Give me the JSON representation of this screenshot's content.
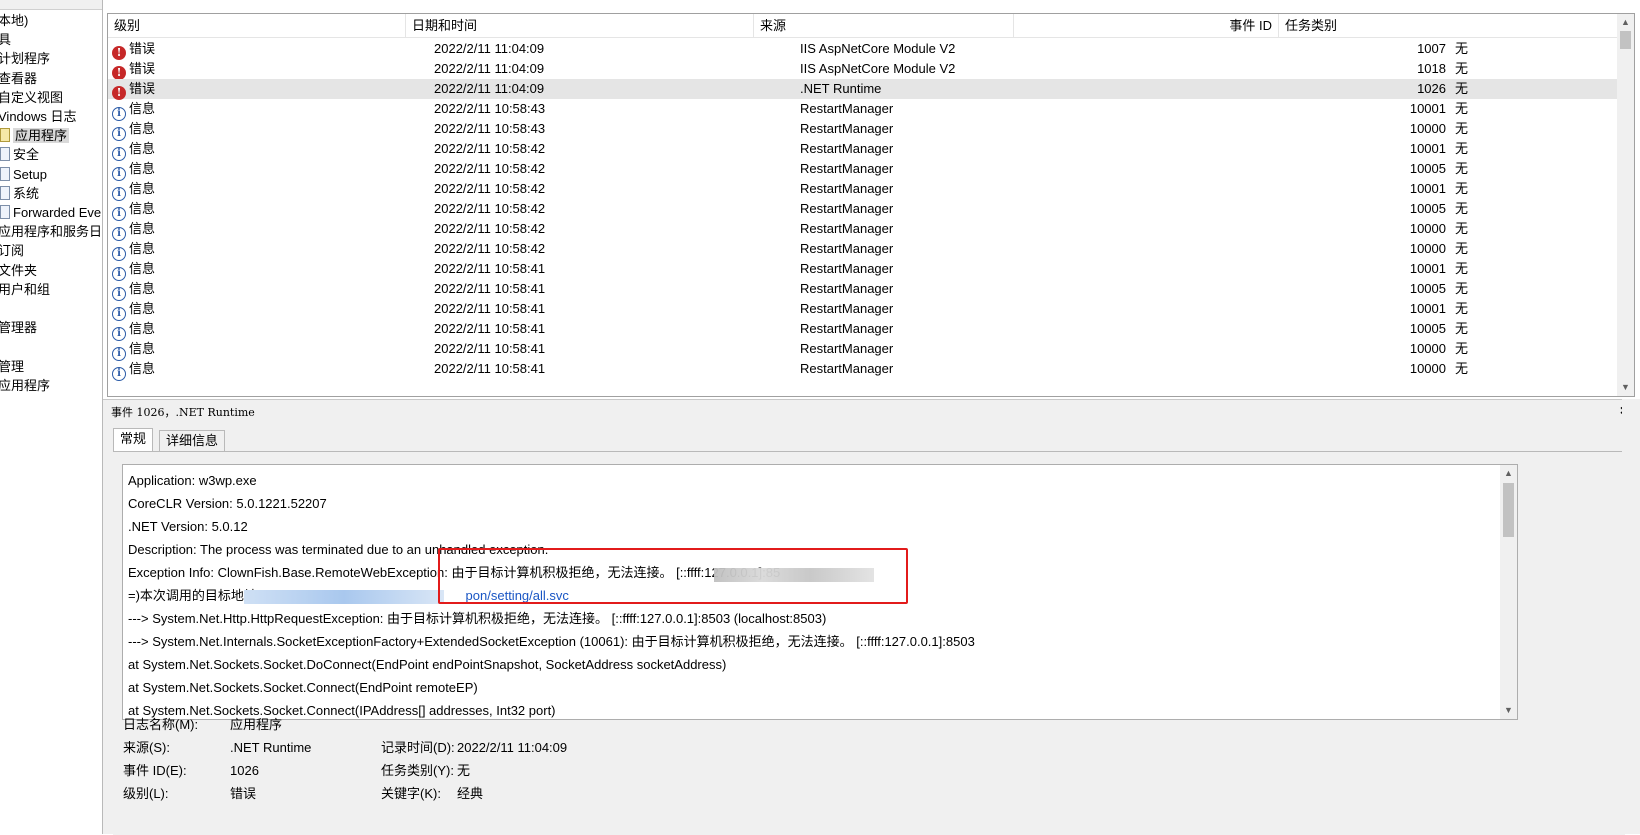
{
  "tree": {
    "items": [
      {
        "label": "本地)",
        "icon": "",
        "selected": false
      },
      {
        "label": "具",
        "icon": "",
        "selected": false
      },
      {
        "label": "计划程序",
        "icon": "",
        "selected": false
      },
      {
        "label": "查看器",
        "icon": "",
        "selected": false
      },
      {
        "label": "自定义视图",
        "icon": "",
        "selected": false
      },
      {
        "label": "Vindows 日志",
        "icon": "",
        "selected": false
      },
      {
        "label": "应用程序",
        "icon": "log-icon",
        "selected": true
      },
      {
        "label": "安全",
        "icon": "log-icon",
        "selected": false
      },
      {
        "label": "Setup",
        "icon": "log-icon",
        "selected": false
      },
      {
        "label": "系统",
        "icon": "log-icon",
        "selected": false
      },
      {
        "label": "Forwarded Eve",
        "icon": "log-icon",
        "selected": false
      },
      {
        "label": "应用程序和服务日志",
        "icon": "",
        "selected": false
      },
      {
        "label": "订阅",
        "icon": "",
        "selected": false
      },
      {
        "label": "文件夹",
        "icon": "",
        "selected": false
      },
      {
        "label": "用户和组",
        "icon": "",
        "selected": false
      },
      {
        "label": "",
        "icon": "",
        "selected": false
      },
      {
        "label": "管理器",
        "icon": "",
        "selected": false
      },
      {
        "label": "",
        "icon": "",
        "selected": false
      },
      {
        "label": "管理",
        "icon": "",
        "selected": false
      },
      {
        "label": "应用程序",
        "icon": "",
        "selected": false
      }
    ]
  },
  "event_list": {
    "columns": {
      "level": "级别",
      "date": "日期和时间",
      "source": "来源",
      "event_id": "事件 ID",
      "task": "任务类别"
    },
    "rows": [
      {
        "level": "错误",
        "type": "error",
        "date": "2022/2/11 11:04:09",
        "source": "IIS AspNetCore Module V2",
        "event_id": "1007",
        "task": "无",
        "selected": false
      },
      {
        "level": "错误",
        "type": "error",
        "date": "2022/2/11 11:04:09",
        "source": "IIS AspNetCore Module V2",
        "event_id": "1018",
        "task": "无",
        "selected": false
      },
      {
        "level": "错误",
        "type": "error",
        "date": "2022/2/11 11:04:09",
        "source": ".NET Runtime",
        "event_id": "1026",
        "task": "无",
        "selected": true
      },
      {
        "level": "信息",
        "type": "info",
        "date": "2022/2/11 10:58:43",
        "source": "RestartManager",
        "event_id": "10001",
        "task": "无",
        "selected": false
      },
      {
        "level": "信息",
        "type": "info",
        "date": "2022/2/11 10:58:43",
        "source": "RestartManager",
        "event_id": "10000",
        "task": "无",
        "selected": false
      },
      {
        "level": "信息",
        "type": "info",
        "date": "2022/2/11 10:58:42",
        "source": "RestartManager",
        "event_id": "10001",
        "task": "无",
        "selected": false
      },
      {
        "level": "信息",
        "type": "info",
        "date": "2022/2/11 10:58:42",
        "source": "RestartManager",
        "event_id": "10005",
        "task": "无",
        "selected": false
      },
      {
        "level": "信息",
        "type": "info",
        "date": "2022/2/11 10:58:42",
        "source": "RestartManager",
        "event_id": "10001",
        "task": "无",
        "selected": false
      },
      {
        "level": "信息",
        "type": "info",
        "date": "2022/2/11 10:58:42",
        "source": "RestartManager",
        "event_id": "10005",
        "task": "无",
        "selected": false
      },
      {
        "level": "信息",
        "type": "info",
        "date": "2022/2/11 10:58:42",
        "source": "RestartManager",
        "event_id": "10000",
        "task": "无",
        "selected": false
      },
      {
        "level": "信息",
        "type": "info",
        "date": "2022/2/11 10:58:42",
        "source": "RestartManager",
        "event_id": "10000",
        "task": "无",
        "selected": false
      },
      {
        "level": "信息",
        "type": "info",
        "date": "2022/2/11 10:58:41",
        "source": "RestartManager",
        "event_id": "10001",
        "task": "无",
        "selected": false
      },
      {
        "level": "信息",
        "type": "info",
        "date": "2022/2/11 10:58:41",
        "source": "RestartManager",
        "event_id": "10005",
        "task": "无",
        "selected": false
      },
      {
        "level": "信息",
        "type": "info",
        "date": "2022/2/11 10:58:41",
        "source": "RestartManager",
        "event_id": "10001",
        "task": "无",
        "selected": false
      },
      {
        "level": "信息",
        "type": "info",
        "date": "2022/2/11 10:58:41",
        "source": "RestartManager",
        "event_id": "10005",
        "task": "无",
        "selected": false
      },
      {
        "level": "信息",
        "type": "info",
        "date": "2022/2/11 10:58:41",
        "source": "RestartManager",
        "event_id": "10000",
        "task": "无",
        "selected": false
      },
      {
        "level": "信息",
        "type": "info",
        "date": "2022/2/11 10:58:41",
        "source": "RestartManager",
        "event_id": "10000",
        "task": "无",
        "selected": false
      }
    ]
  },
  "detail": {
    "title": "事件 1026，.NET Runtime",
    "close": "×",
    "tabs": {
      "general": "常规",
      "details": "详细信息"
    },
    "text_lines": [
      {
        "text": "Application: w3wp.exe",
        "link": ""
      },
      {
        "text": "CoreCLR Version: 5.0.1221.52207",
        "link": ""
      },
      {
        "text": ".NET Version: 5.0.12",
        "link": ""
      },
      {
        "text": "Description: The process was terminated due to an unhandled exception.",
        "link": ""
      },
      {
        "text": "Exception Info: ClownFish.Base.RemoteWebException: 由于目标计算机积极拒绝，无法连接。 [::ffff:127.0.0.1]:85",
        "link": ""
      },
      {
        "text": "=)本次调用的目标地址:",
        "link": "pon/setting/all.svc"
      },
      {
        "text": " ---> System.Net.Http.HttpRequestException: 由于目标计算机积极拒绝，无法连接。 [::ffff:127.0.0.1]:8503 (localhost:8503)",
        "link": ""
      },
      {
        "text": " ---> System.Net.Internals.SocketExceptionFactory+ExtendedSocketException (10061): 由于目标计算机积极拒绝，无法连接。 [::ffff:127.0.0.1]:8503",
        "link": ""
      },
      {
        "text": "   at System.Net.Sockets.Socket.DoConnect(EndPoint endPointSnapshot, SocketAddress socketAddress)",
        "link": ""
      },
      {
        "text": "   at System.Net.Sockets.Socket.Connect(EndPoint remoteEP)",
        "link": ""
      },
      {
        "text": "   at System.Net.Sockets.Socket.Connect(IPAddress[] addresses, Int32 port)",
        "link": ""
      }
    ],
    "fields": {
      "log_name_label": "日志名称(M):",
      "log_name_value": "应用程序",
      "source_label": "来源(S):",
      "source_value": ".NET Runtime",
      "logged_label": "记录时间(D):",
      "logged_value": "2022/2/11 11:04:09",
      "event_id_label": "事件 ID(E):",
      "event_id_value": "1026",
      "task_label": "任务类别(Y):",
      "task_value": "无",
      "level_label": "级别(L):",
      "level_value": "错误",
      "keywords_label": "关键字(K):",
      "keywords_value": "经典"
    }
  },
  "colors": {
    "highlight_box": "#e21b1b",
    "error_icon": "#c62828",
    "info_icon": "#2a5aa7",
    "link": "#1a56c4",
    "selected_row": "#e5e5e5"
  }
}
